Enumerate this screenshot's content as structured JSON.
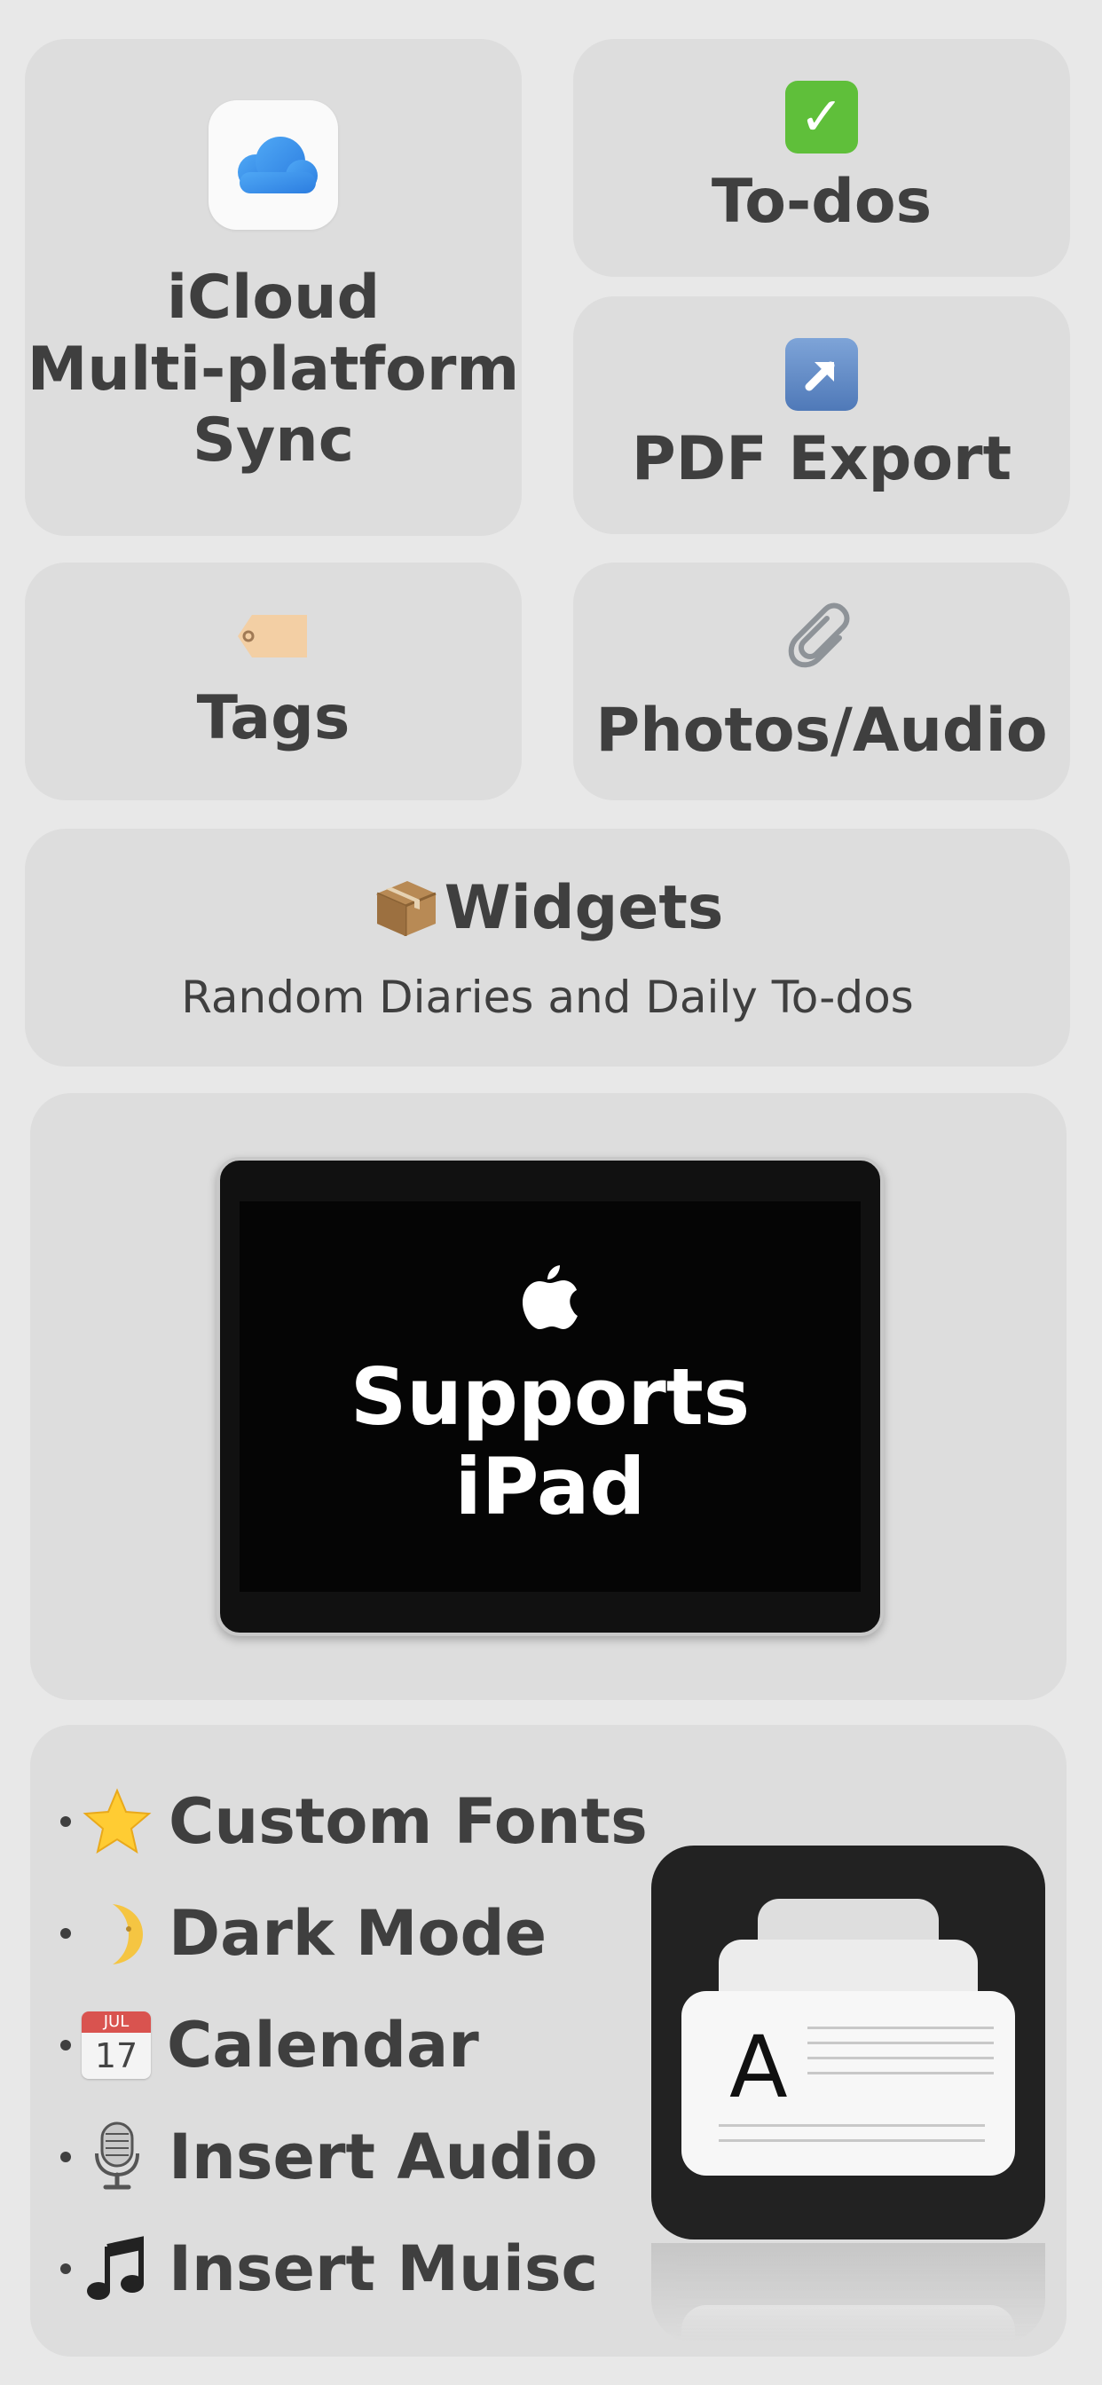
{
  "cards": {
    "icloud": {
      "line1": "iCloud",
      "line2": "Multi-platform",
      "line3": "Sync"
    },
    "todos": {
      "label": "To-dos"
    },
    "pdf": {
      "label": "PDF Export"
    },
    "tags": {
      "label": "Tags"
    },
    "photos": {
      "label": "Photos/Audio"
    },
    "widgets": {
      "title": "Widgets",
      "subtitle": "Random Diaries and Daily To-dos"
    },
    "ipad": {
      "line1": "Supports",
      "line2": "iPad"
    }
  },
  "features": [
    {
      "label": "Custom Fonts",
      "icon": "star-icon"
    },
    {
      "label": "Dark Mode",
      "icon": "moon-icon"
    },
    {
      "label": "Calendar",
      "icon": "calendar-icon"
    },
    {
      "label": "Insert Audio",
      "icon": "microphone-icon"
    },
    {
      "label": "Insert Muisc",
      "icon": "music-note-icon"
    }
  ],
  "calendar_icon": {
    "month": "JUL",
    "day": "17"
  },
  "app_icon": {
    "letter": "A"
  },
  "colors": {
    "background": "#e8e8e8",
    "card": "#dddddd",
    "text": "#3f3f3f",
    "check_green": "#5fbf3a",
    "ipad_screen": "#050505"
  }
}
